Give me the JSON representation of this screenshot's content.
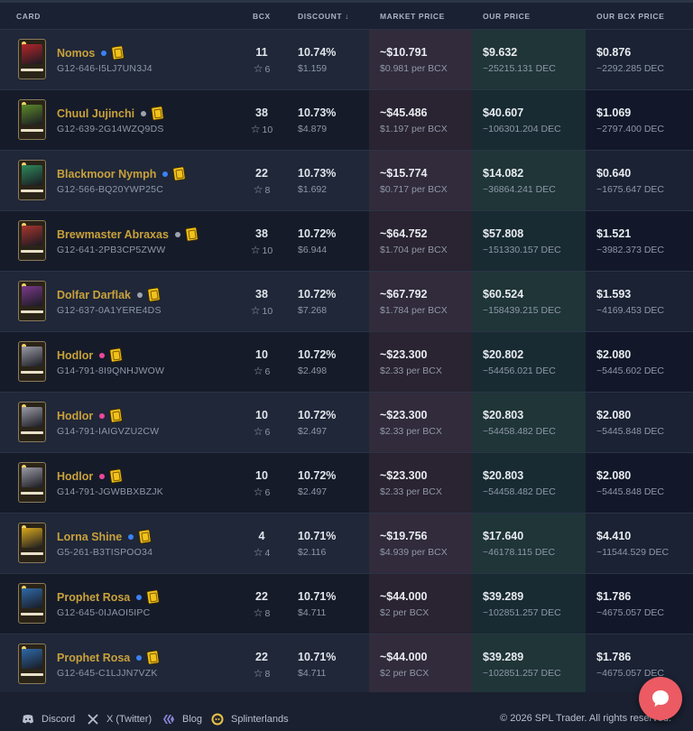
{
  "headers": {
    "card": "CARD",
    "bcx": "BCX",
    "discount": "DISCOUNT ↓",
    "market_price": "MARKET PRICE",
    "our_price": "OUR PRICE",
    "our_bcx_price": "OUR BCX PRICE"
  },
  "rows": [
    {
      "name": "Nomos",
      "uid": "G12-646-I5LJ7UN3J4",
      "dot": "#3b82f6",
      "bcx": "11",
      "stars": "6",
      "discount": "10.74%",
      "discount_value": "$1.159",
      "market": "~$10.791",
      "market_sub": "$0.981 per BCX",
      "our": "$9.632",
      "our_sub": "~25215.131 DEC",
      "bcx_price": "$0.876",
      "bcx_price_sub": "~2292.285 DEC",
      "art": "#b3262a"
    },
    {
      "name": "Chuul Jujinchi",
      "uid": "G12-639-2G14WZQ9DS",
      "dot": "#9ca3af",
      "bcx": "38",
      "stars": "10",
      "discount": "10.73%",
      "discount_value": "$4.879",
      "market": "~$45.486",
      "market_sub": "$1.197 per BCX",
      "our": "$40.607",
      "our_sub": "~106301.204 DEC",
      "bcx_price": "$1.069",
      "bcx_price_sub": "~2797.400 DEC",
      "art": "#5c8a2a"
    },
    {
      "name": "Blackmoor Nymph",
      "uid": "G12-566-BQ20YWP25C",
      "dot": "#3b82f6",
      "bcx": "22",
      "stars": "8",
      "discount": "10.73%",
      "discount_value": "$1.692",
      "market": "~$15.774",
      "market_sub": "$0.717 per BCX",
      "our": "$14.082",
      "our_sub": "~36864.241 DEC",
      "bcx_price": "$0.640",
      "bcx_price_sub": "~1675.647 DEC",
      "art": "#2e8a5a"
    },
    {
      "name": "Brewmaster Abraxas",
      "uid": "G12-641-2PB3CP5ZWW",
      "dot": "#9ca3af",
      "bcx": "38",
      "stars": "10",
      "discount": "10.72%",
      "discount_value": "$6.944",
      "market": "~$64.752",
      "market_sub": "$1.704 per BCX",
      "our": "$57.808",
      "our_sub": "~151330.157 DEC",
      "bcx_price": "$1.521",
      "bcx_price_sub": "~3982.373 DEC",
      "art": "#a8352e"
    },
    {
      "name": "Dolfar Darflak",
      "uid": "G12-637-0A1YERE4DS",
      "dot": "#9ca3af",
      "bcx": "38",
      "stars": "10",
      "discount": "10.72%",
      "discount_value": "$7.268",
      "market": "~$67.792",
      "market_sub": "$1.784 per BCX",
      "our": "$60.524",
      "our_sub": "~158439.215 DEC",
      "bcx_price": "$1.593",
      "bcx_price_sub": "~4169.453 DEC",
      "art": "#7a3a8a"
    },
    {
      "name": "Hodlor",
      "uid": "G14-791-8I9QNHJWOW",
      "dot": "#ec4899",
      "bcx": "10",
      "stars": "6",
      "discount": "10.72%",
      "discount_value": "$2.498",
      "market": "~$23.300",
      "market_sub": "$2.33 per BCX",
      "our": "$20.802",
      "our_sub": "~54456.021 DEC",
      "bcx_price": "$2.080",
      "bcx_price_sub": "~5445.602 DEC",
      "art": "#9a9aa5"
    },
    {
      "name": "Hodlor",
      "uid": "G14-791-IAIGVZU2CW",
      "dot": "#ec4899",
      "bcx": "10",
      "stars": "6",
      "discount": "10.72%",
      "discount_value": "$2.497",
      "market": "~$23.300",
      "market_sub": "$2.33 per BCX",
      "our": "$20.803",
      "our_sub": "~54458.482 DEC",
      "bcx_price": "$2.080",
      "bcx_price_sub": "~5445.848 DEC",
      "art": "#9a9aa5"
    },
    {
      "name": "Hodlor",
      "uid": "G14-791-JGWBBXBZJK",
      "dot": "#ec4899",
      "bcx": "10",
      "stars": "6",
      "discount": "10.72%",
      "discount_value": "$2.497",
      "market": "~$23.300",
      "market_sub": "$2.33 per BCX",
      "our": "$20.803",
      "our_sub": "~54458.482 DEC",
      "bcx_price": "$2.080",
      "bcx_price_sub": "~5445.848 DEC",
      "art": "#9a9aa5"
    },
    {
      "name": "Lorna Shine",
      "uid": "G5-261-B3TISPOO34",
      "dot": "#3b82f6",
      "bcx": "4",
      "stars": "4",
      "discount": "10.71%",
      "discount_value": "$2.116",
      "market": "~$19.756",
      "market_sub": "$4.939 per BCX",
      "our": "$17.640",
      "our_sub": "~46178.115 DEC",
      "bcx_price": "$4.410",
      "bcx_price_sub": "~11544.529 DEC",
      "art": "#d9a81c"
    },
    {
      "name": "Prophet Rosa",
      "uid": "G12-645-0IJAOI5IPC",
      "dot": "#3b82f6",
      "bcx": "22",
      "stars": "8",
      "discount": "10.71%",
      "discount_value": "$4.711",
      "market": "~$44.000",
      "market_sub": "$2 per BCX",
      "our": "$39.289",
      "our_sub": "~102851.257 DEC",
      "bcx_price": "$1.786",
      "bcx_price_sub": "~4675.057 DEC",
      "art": "#2e6aa8"
    },
    {
      "name": "Prophet Rosa",
      "uid": "G12-645-C1LJJN7VZK",
      "dot": "#3b82f6",
      "bcx": "22",
      "stars": "8",
      "discount": "10.71%",
      "discount_value": "$4.711",
      "market": "~$44.000",
      "market_sub": "$2 per BCX",
      "our": "$39.289",
      "our_sub": "~102851.257 DEC",
      "bcx_price": "$1.786",
      "bcx_price_sub": "~4675.057 DEC",
      "art": "#2e6aa8"
    }
  ],
  "footer": {
    "discord": "Discord",
    "twitter": "X (Twitter)",
    "blog": "Blog",
    "splinterlands": "Splinterlands",
    "copyright": "© 2026 SPL Trader. All rights reserved."
  }
}
